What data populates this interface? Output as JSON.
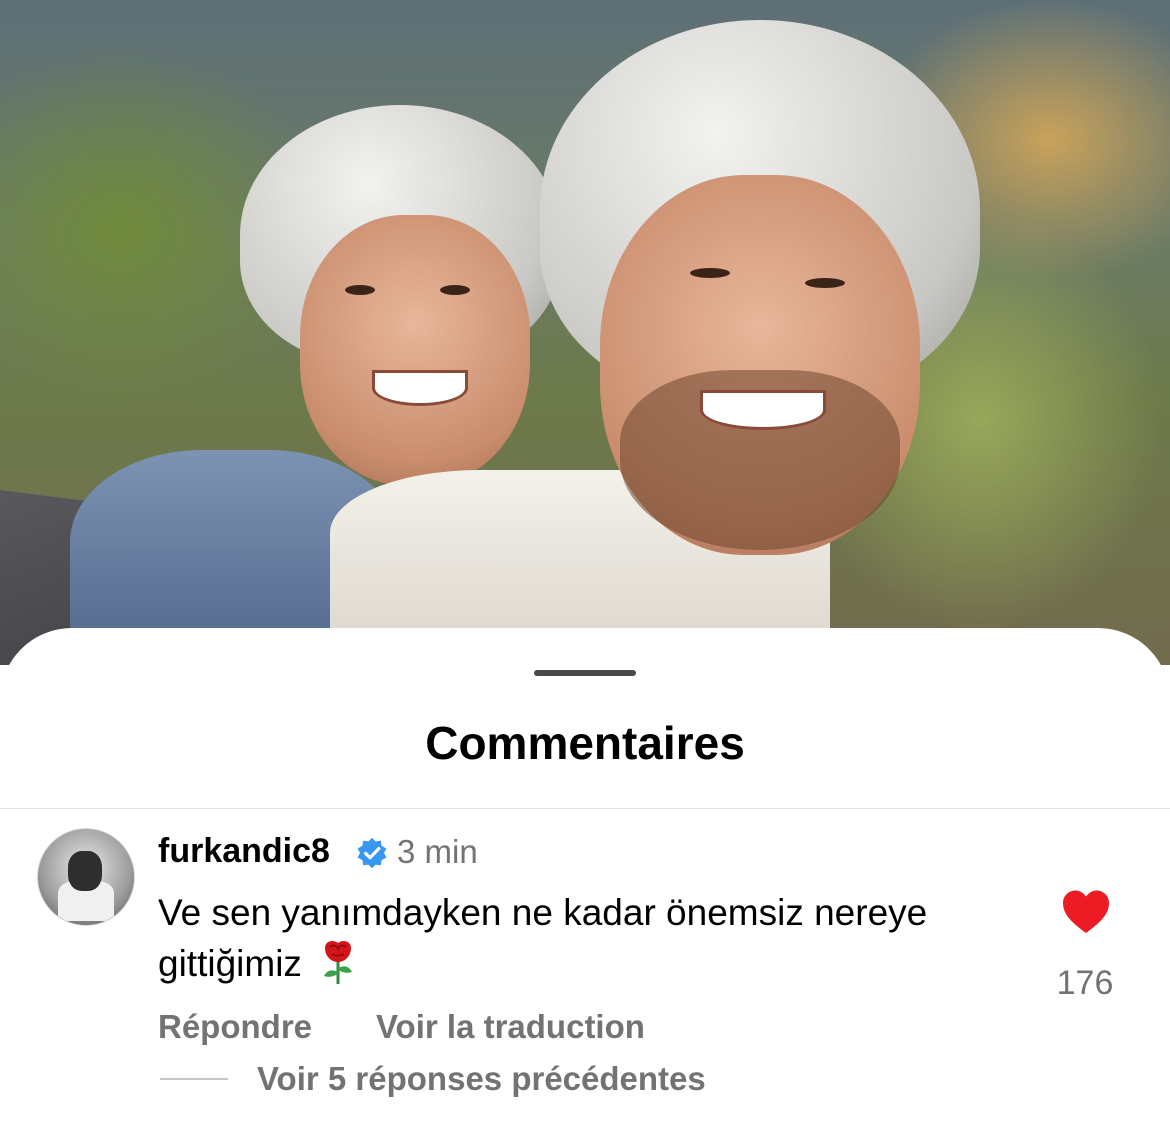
{
  "sheet": {
    "title": "Commentaires"
  },
  "comment": {
    "username": "furkandic8",
    "verified": true,
    "timestamp": "3 min",
    "text": "Ve sen yanımdayken ne kadar önemsiz nereye gittiğimiz",
    "emoji": "rose-icon",
    "likes": "176",
    "liked": true,
    "reply_label": "Répondre",
    "translate_label": "Voir la traduction",
    "view_replies_label": "Voir 5 réponses précédentes"
  },
  "colors": {
    "heart": "#ed1c24",
    "verified_badge": "#3897f0",
    "secondary_text": "#737373"
  }
}
